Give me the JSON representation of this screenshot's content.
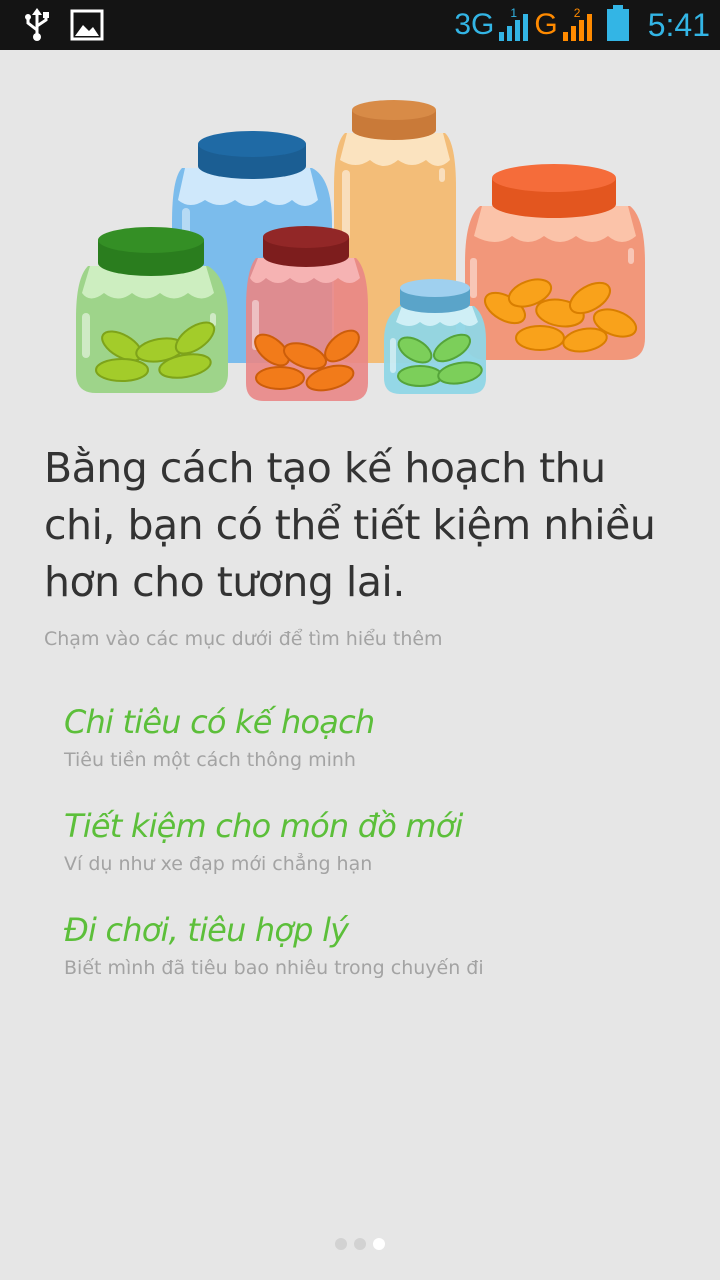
{
  "status_bar": {
    "net1": "3G",
    "sim1": "1",
    "net2": "G",
    "sim2": "2",
    "time": "5:41",
    "icons": [
      "usb-icon",
      "image-icon",
      "signal-icon",
      "battery-icon"
    ],
    "accent_color": "#33b5e5",
    "net2_color": "#ff8a00"
  },
  "illustration": {
    "icon": "savings-jars-illustration"
  },
  "headline": "Bằng cách tạo kế hoạch thu chi, bạn có thể tiết kiệm nhiều hơn cho tương lai.",
  "hint": "Chạm vào các mục dưới để tìm hiểu thêm",
  "options": [
    {
      "title": "Chi tiêu có kế hoạch",
      "subtitle": "Tiêu tiền một cách thông minh"
    },
    {
      "title": "Tiết kiệm cho món đồ mới",
      "subtitle": "Ví dụ như xe đạp mới chẳng hạn"
    },
    {
      "title": "Đi chơi, tiêu hợp lý",
      "subtitle": "Biết mình đã tiêu bao nhiêu trong chuyến đi"
    }
  ],
  "pager": {
    "pages": 3,
    "active_index": 2
  },
  "colors": {
    "background": "#e6e6e6",
    "option_title": "#5cbf3a",
    "text_secondary": "#a3a3a3",
    "text_primary": "#333333"
  }
}
